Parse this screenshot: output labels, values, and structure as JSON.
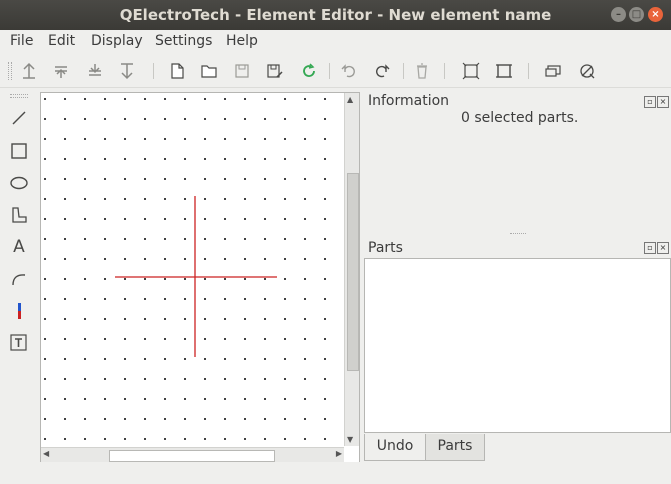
{
  "window": {
    "title": "QElectroTech - Element Editor - New element name"
  },
  "menu": [
    "File",
    "Edit",
    "Display",
    "Settings",
    "Help"
  ],
  "toolbar": {
    "icons": [
      "bring-forward-icon",
      "raise-icon",
      "lower-icon",
      "send-backward-icon",
      "new-document-icon",
      "open-folder-icon",
      "save-icon",
      "save-as-icon",
      "reload-icon",
      "undo-icon",
      "redo-icon",
      "delete-icon",
      "zoom-fit-icon",
      "zoom-reset-icon",
      "edit-properties-icon",
      "edit-author-icon"
    ]
  },
  "tools": [
    "line-tool-icon",
    "rectangle-tool-icon",
    "ellipse-tool-icon",
    "polygon-tool-icon",
    "text-tool-icon",
    "arc-tool-icon",
    "terminal-tool-icon",
    "dynamic-text-tool-icon"
  ],
  "information": {
    "title": "Information",
    "status": "0 selected parts."
  },
  "parts": {
    "title": "Parts"
  },
  "tabs": [
    "Undo",
    "Parts"
  ],
  "colors": {
    "crosshair": "#cc2222",
    "accent": "#e9643b"
  }
}
